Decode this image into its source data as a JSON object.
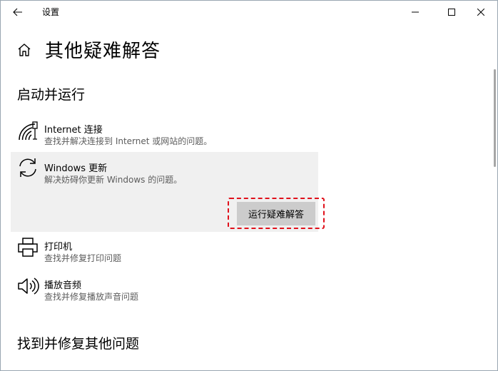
{
  "window": {
    "title": "设置"
  },
  "header": {
    "page_title": "其他疑难解答"
  },
  "sections": {
    "startup": "启动并运行",
    "other": "找到并修复其他问题"
  },
  "items": {
    "internet": {
      "name": "Internet 连接",
      "desc": "查找并解决连接到 Internet 或网站的问题。",
      "icon": "wifi-globe-icon"
    },
    "update": {
      "name": "Windows 更新",
      "desc": "解决妨碍你更新 Windows 的问题。",
      "icon": "sync-icon",
      "run_label": "运行疑难解答"
    },
    "printer": {
      "name": "打印机",
      "desc": "查找并修复打印问题",
      "icon": "printer-icon"
    },
    "audio": {
      "name": "播放音频",
      "desc": "查找并修复播放声音问题",
      "icon": "speaker-icon"
    }
  },
  "colors": {
    "selected_bg": "#f0f0f0",
    "button_bg": "#cccccc",
    "highlight": "#e0111b"
  }
}
